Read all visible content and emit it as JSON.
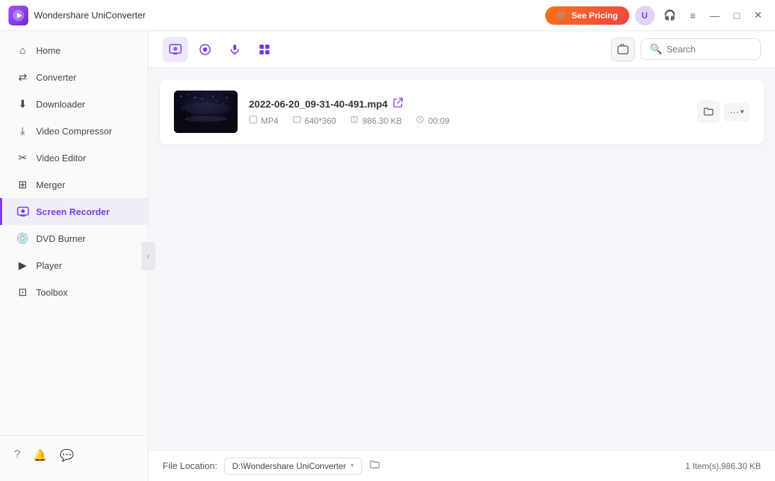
{
  "app": {
    "title": "Wondershare UniConverter",
    "icon": "▶"
  },
  "titlebar": {
    "see_pricing": "See Pricing",
    "pricing_icon": "🛒",
    "minimize": "—",
    "maximize": "□",
    "close": "✕",
    "hamburger": "≡",
    "headphone": "🎧"
  },
  "sidebar": {
    "items": [
      {
        "id": "home",
        "label": "Home",
        "icon": "⌂"
      },
      {
        "id": "converter",
        "label": "Converter",
        "icon": "⇄"
      },
      {
        "id": "downloader",
        "label": "Downloader",
        "icon": "⬇"
      },
      {
        "id": "video-compressor",
        "label": "Video Compressor",
        "icon": "⤓"
      },
      {
        "id": "video-editor",
        "label": "Video Editor",
        "icon": "✂"
      },
      {
        "id": "merger",
        "label": "Merger",
        "icon": "⊞"
      },
      {
        "id": "screen-recorder",
        "label": "Screen Recorder",
        "icon": "⬛",
        "active": true
      },
      {
        "id": "dvd-burner",
        "label": "DVD Burner",
        "icon": "💿"
      },
      {
        "id": "player",
        "label": "Player",
        "icon": "▶"
      },
      {
        "id": "toolbox",
        "label": "Toolbox",
        "icon": "⊡"
      }
    ],
    "bottom_icons": [
      "?",
      "🔔",
      "😊"
    ]
  },
  "content_header": {
    "tabs": [
      {
        "id": "screen",
        "icon": "⬛",
        "active": true
      },
      {
        "id": "camera",
        "icon": "📷",
        "active": false
      },
      {
        "id": "audio",
        "icon": "🎙",
        "active": false
      },
      {
        "id": "apps",
        "icon": "⊞",
        "active": false
      }
    ],
    "search_placeholder": "Search"
  },
  "file": {
    "name": "2022-06-20_09-31-40-491.mp4",
    "format": "MP4",
    "resolution": "640*360",
    "size": "986.30 KB",
    "duration": "00:09"
  },
  "footer": {
    "file_location_label": "File Location:",
    "file_location_path": "D:\\Wondershare UniConverter",
    "file_count": "1 Item(s),986.30 KB"
  }
}
